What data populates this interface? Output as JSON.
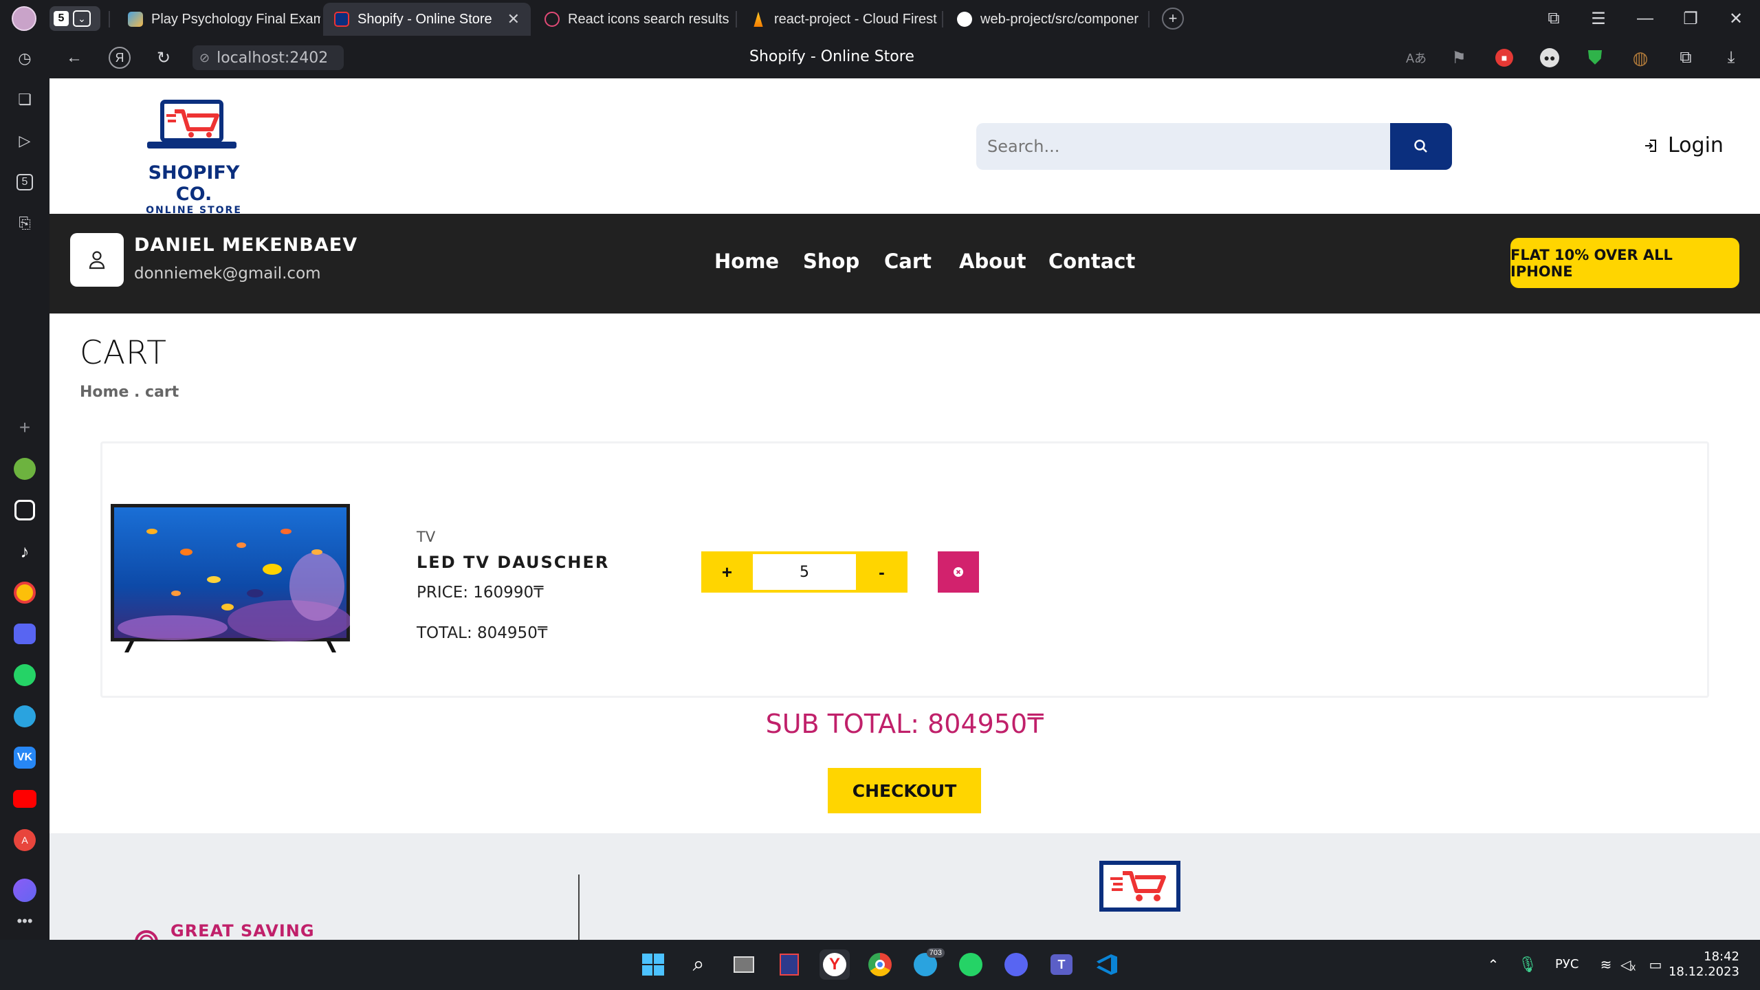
{
  "browser": {
    "tab_count": "5",
    "tabs": [
      {
        "label": "Play Psychology Final Exam"
      },
      {
        "label": "Shopify - Online Store",
        "close": "✕"
      },
      {
        "label": "React icons search results"
      },
      {
        "label": "react-project - Cloud Firest"
      },
      {
        "label": "web-project/src/componer"
      }
    ],
    "address": "localhost:2402",
    "page_title": "Shopify - Online Store"
  },
  "site": {
    "brand": "SHOPIFY CO.",
    "brand_sub": "ONLINE STORE",
    "search_placeholder": "Search...",
    "login_label": "Login",
    "user_name": "DANIEL MEKENBAEV",
    "user_email": "donniemek@gmail.com",
    "nav": [
      "Home",
      "Shop",
      "Cart",
      "About",
      "Contact"
    ],
    "promo": "FLAT 10% OVER ALL IPHONE"
  },
  "cart": {
    "title": "CART",
    "breadcrumb": "Home . cart",
    "item": {
      "category": "TV",
      "name": "LED TV DAUSCHER",
      "price": "PRICE: 160990₸",
      "total": "TOTAL: 804950₸",
      "quantity": "5",
      "plus": "+",
      "minus": "-"
    },
    "subtotal": "SUB TOTAL: 804950₸",
    "checkout": "CHECKOUT"
  },
  "footer": {
    "saving": "GREAT SAVING"
  },
  "taskbar": {
    "lang": "РУС",
    "time": "18:42",
    "date": "18.12.2023",
    "telegram_badge": "703"
  },
  "colors": {
    "accent_yellow": "#ffd500",
    "brand_navy": "#0b2f7e",
    "accent_pink": "#c0206a",
    "nav_dark": "#212121"
  }
}
